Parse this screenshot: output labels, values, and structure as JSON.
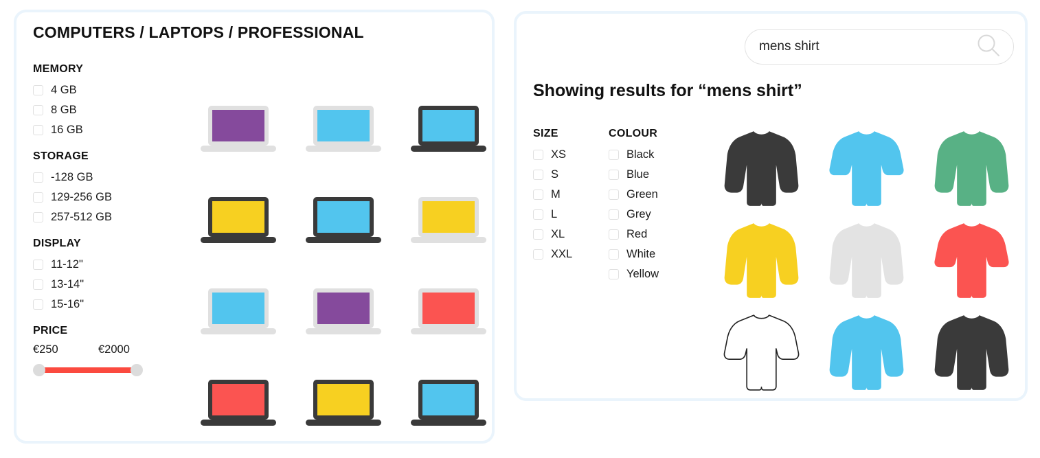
{
  "colors": {
    "panel_border": "#eaf4fc",
    "slider_track": "#fb4a3f",
    "slider_knob": "#dcdcdc",
    "checkbox_border": "#e0e0e0",
    "purple": "#854a9c",
    "blue": "#52c5ee",
    "yellow": "#f7d021",
    "red": "#fb5451",
    "green": "#58b185",
    "dark": "#3a3a3a",
    "light_bezel": "#e0e0e0",
    "light_grey_shirt": "#e3e3e3",
    "white_shirt_outline": "#222222"
  },
  "laptop_panel": {
    "category_title": "COMPUTERS / LAPTOPS / PROFESSIONAL",
    "filter_groups": [
      {
        "title": "MEMORY",
        "options": [
          "4 GB",
          "8 GB",
          "16 GB"
        ]
      },
      {
        "title": "STORAGE",
        "options": [
          "-128 GB",
          "129-256 GB",
          "257-512 GB"
        ]
      },
      {
        "title": "DISPLAY",
        "options": [
          "11-12\"",
          "13-14\"",
          "15-16\""
        ]
      }
    ],
    "price": {
      "title": "PRICE",
      "min_label": "€250",
      "max_label": "€2000"
    },
    "products": [
      {
        "name": "laptop-purple-light",
        "bezel": "light",
        "screen": "#854a9c"
      },
      {
        "name": "laptop-blue-light",
        "bezel": "light",
        "screen": "#52c5ee"
      },
      {
        "name": "laptop-blue-dark",
        "bezel": "dark",
        "screen": "#52c5ee"
      },
      {
        "name": "laptop-yellow-dark",
        "bezel": "dark",
        "screen": "#f7d021"
      },
      {
        "name": "laptop-blue-dark-2",
        "bezel": "dark",
        "screen": "#52c5ee"
      },
      {
        "name": "laptop-yellow-light",
        "bezel": "light",
        "screen": "#f7d021"
      },
      {
        "name": "laptop-blue-light-2",
        "bezel": "light",
        "screen": "#52c5ee"
      },
      {
        "name": "laptop-purple-light-2",
        "bezel": "light",
        "screen": "#854a9c"
      },
      {
        "name": "laptop-red-light",
        "bezel": "light",
        "screen": "#fb5451"
      },
      {
        "name": "laptop-red-dark",
        "bezel": "dark",
        "screen": "#fb5451"
      },
      {
        "name": "laptop-yellow-dark-2",
        "bezel": "dark",
        "screen": "#f7d021"
      },
      {
        "name": "laptop-blue-dark-3",
        "bezel": "dark",
        "screen": "#52c5ee"
      }
    ]
  },
  "shirt_panel": {
    "search": {
      "value": "mens shirt",
      "placeholder": "Search",
      "icon": "search-icon"
    },
    "results_heading": "Showing results for “mens shirt”",
    "filter_groups": [
      {
        "title": "SIZE",
        "options": [
          "XS",
          "S",
          "M",
          "L",
          "XL",
          "XXL"
        ]
      },
      {
        "title": "COLOUR",
        "options": [
          "Black",
          "Blue",
          "Green",
          "Grey",
          "Red",
          "White",
          "Yellow"
        ]
      }
    ],
    "products": [
      {
        "name": "shirt-black-long",
        "sleeve": "long",
        "fill": "#3a3a3a",
        "stroke": "none"
      },
      {
        "name": "shirt-blue-short",
        "sleeve": "short",
        "fill": "#52c5ee",
        "stroke": "none"
      },
      {
        "name": "shirt-green-long",
        "sleeve": "long",
        "fill": "#58b185",
        "stroke": "none"
      },
      {
        "name": "shirt-yellow-long",
        "sleeve": "long",
        "fill": "#f7d021",
        "stroke": "none"
      },
      {
        "name": "shirt-grey-long",
        "sleeve": "long",
        "fill": "#e3e3e3",
        "stroke": "none"
      },
      {
        "name": "shirt-red-short",
        "sleeve": "short",
        "fill": "#fb5451",
        "stroke": "none"
      },
      {
        "name": "shirt-white-short",
        "sleeve": "short",
        "fill": "#ffffff",
        "stroke": "#222222"
      },
      {
        "name": "shirt-blue-long",
        "sleeve": "long",
        "fill": "#52c5ee",
        "stroke": "none"
      },
      {
        "name": "shirt-black-long-2",
        "sleeve": "long",
        "fill": "#3a3a3a",
        "stroke": "none"
      }
    ]
  }
}
